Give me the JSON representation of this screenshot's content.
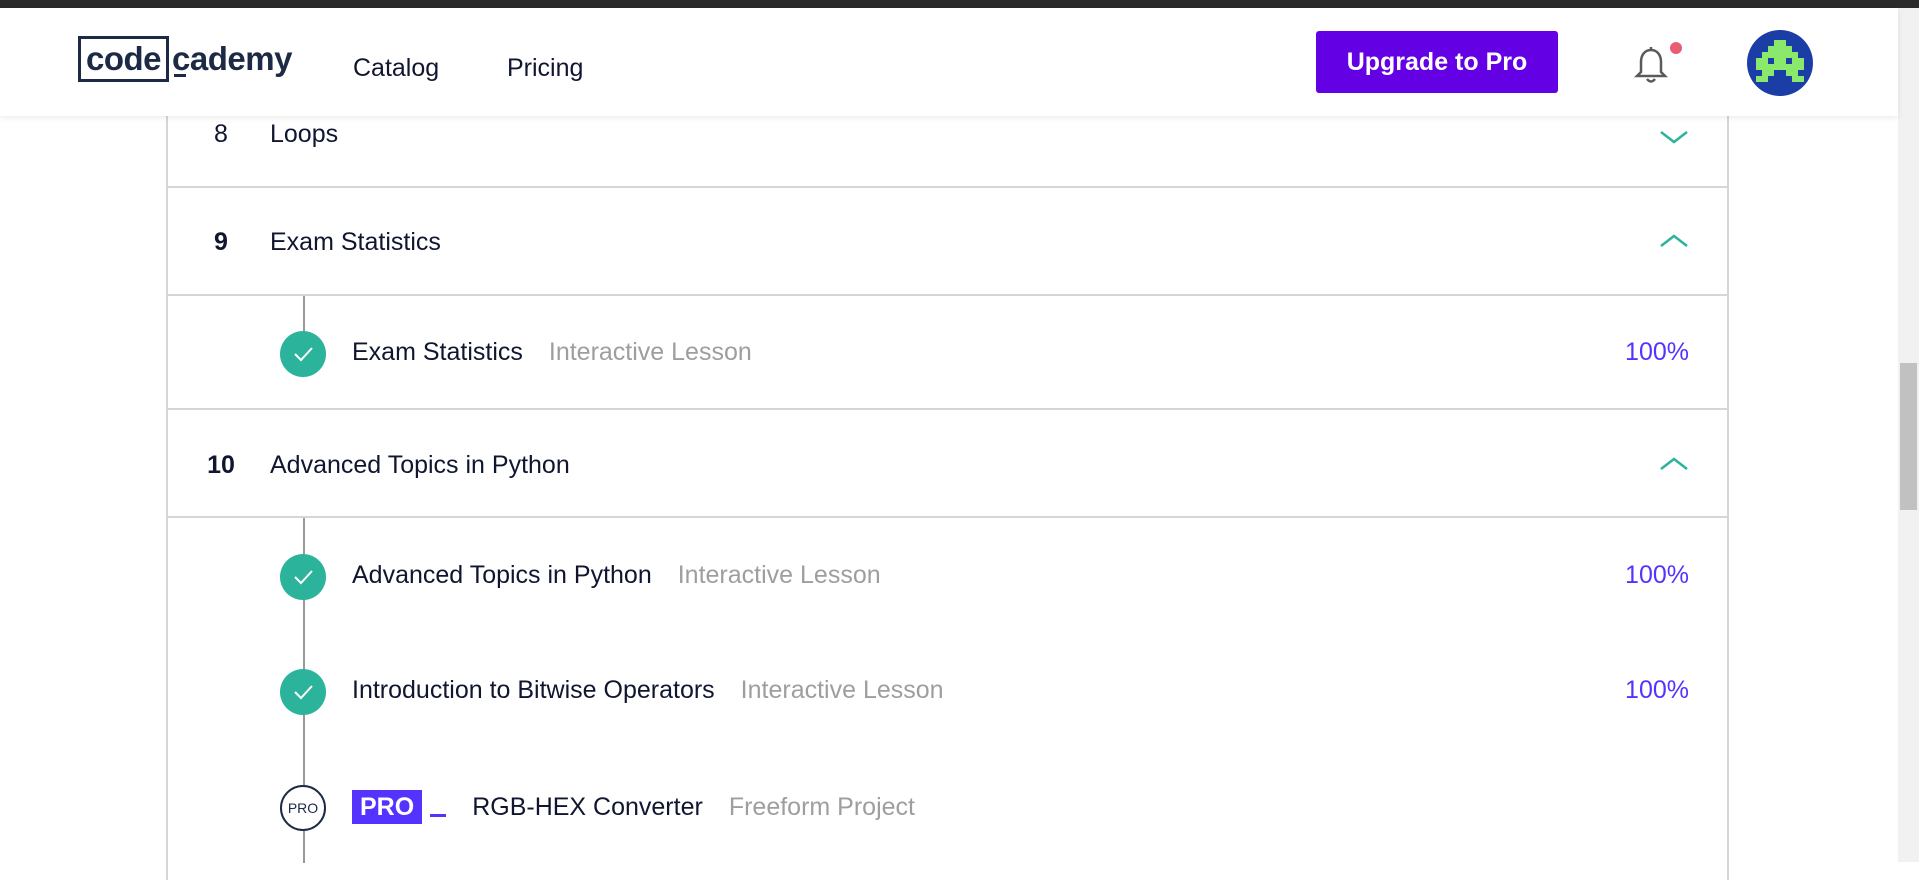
{
  "header": {
    "logo_box": "code",
    "logo_rest": "cademy",
    "nav": {
      "catalog": "Catalog",
      "pricing": "Pricing"
    },
    "upgrade_label": "Upgrade to Pro",
    "icons": {
      "bell": "bell-icon",
      "avatar": "avatar-icon"
    }
  },
  "colors": {
    "brand_purple": "#6400e4",
    "progress_blue": "#5533ff",
    "check_teal": "#2bb39c",
    "notification_dot": "#e85d75"
  },
  "modules": [
    {
      "number": "8",
      "title": "Loops",
      "expanded": false
    },
    {
      "number": "9",
      "title": "Exam Statistics",
      "expanded": true,
      "lessons": [
        {
          "name": "Exam Statistics",
          "type": "Interactive Lesson",
          "progress": "100%",
          "completed": true
        }
      ]
    },
    {
      "number": "10",
      "title": "Advanced Topics in Python",
      "expanded": true,
      "lessons": [
        {
          "name": "Advanced Topics in Python",
          "type": "Interactive Lesson",
          "progress": "100%",
          "completed": true
        },
        {
          "name": "Introduction to Bitwise Operators",
          "type": "Interactive Lesson",
          "progress": "100%",
          "completed": true
        },
        {
          "name": "RGB-HEX Converter",
          "type": "Freeform Project",
          "pro_badge": "PRO",
          "pro_circle": "PRO",
          "locked_pro": true
        }
      ]
    }
  ]
}
